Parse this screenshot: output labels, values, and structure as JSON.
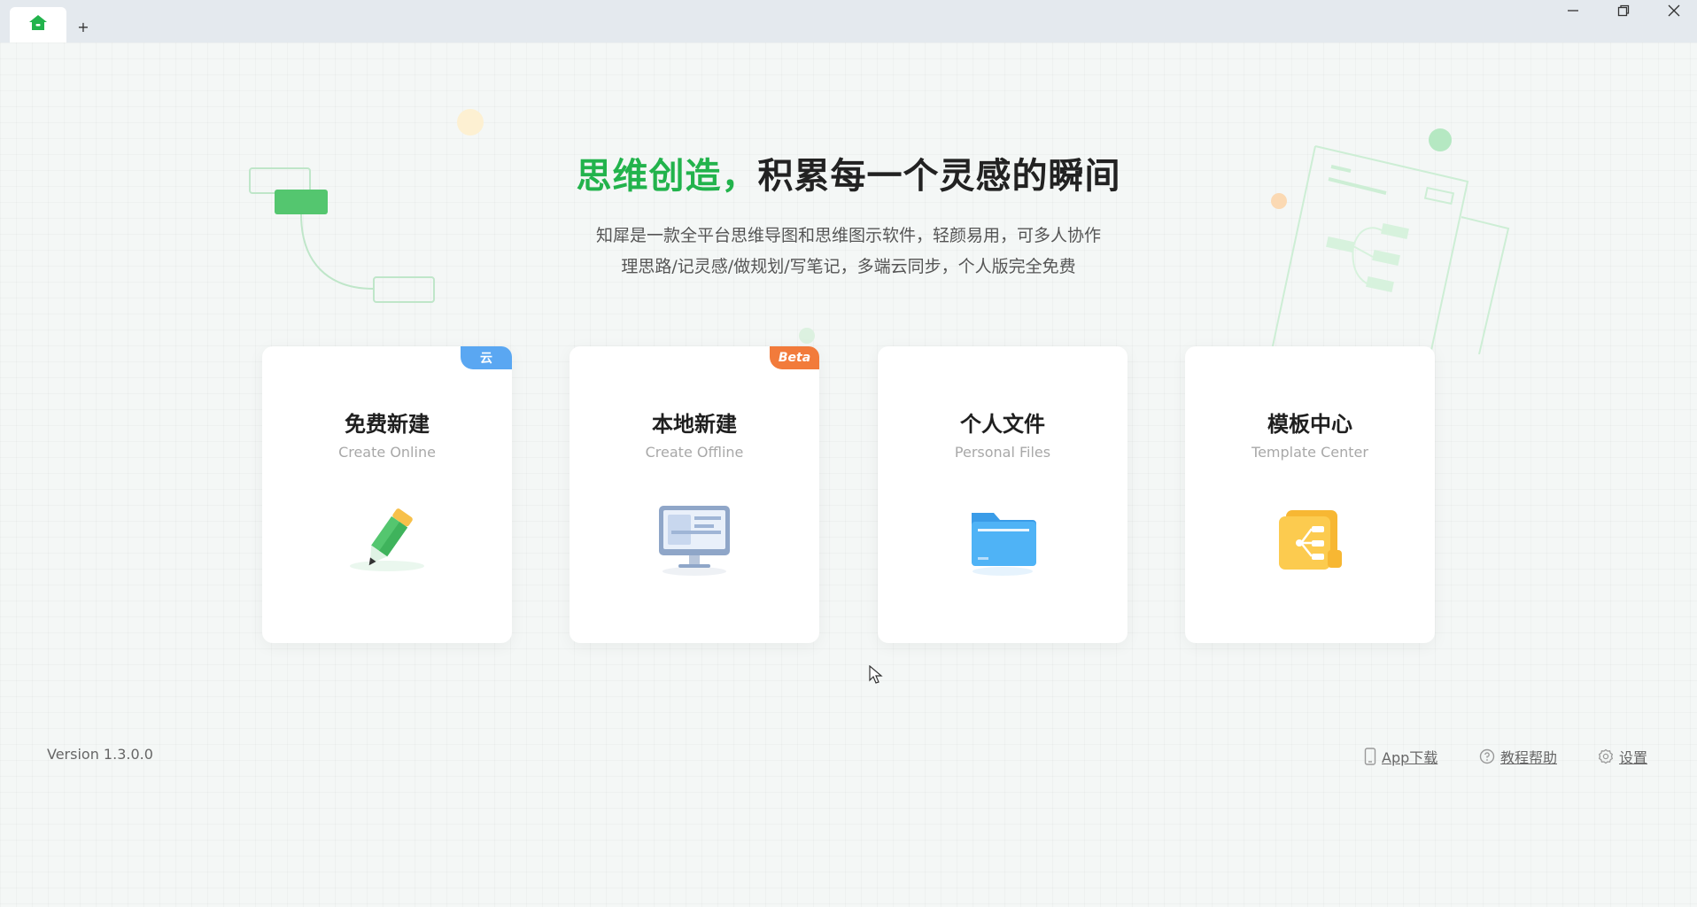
{
  "titlebar": {
    "tabs": [
      {
        "icon": "home-icon"
      }
    ],
    "add_tab_label": "+",
    "window_controls": [
      "minimize-icon",
      "restore-icon",
      "close-icon"
    ]
  },
  "hero": {
    "title_accent": "思维创造，",
    "title_rest": "积累每一个灵感的瞬间",
    "subtitle_line1": "知犀是一款全平台思维导图和思维图示软件，轻颜易用，可多人协作",
    "subtitle_line2": "理思路/记灵感/做规划/写笔记，多端云同步，个人版完全免费"
  },
  "cards": [
    {
      "title": "免费新建",
      "subtitle": "Create Online",
      "badge": "云",
      "badge_color": "#5aa7f2",
      "icon": "pencil-icon"
    },
    {
      "title": "本地新建",
      "subtitle": "Create Offline",
      "badge": "Beta",
      "badge_color": "#f27b3b",
      "icon": "monitor-icon"
    },
    {
      "title": "个人文件",
      "subtitle": "Personal Files",
      "badge": "",
      "icon": "folder-icon"
    },
    {
      "title": "模板中心",
      "subtitle": "Template Center",
      "badge": "",
      "icon": "template-icon"
    }
  ],
  "footer": {
    "version": "Version 1.3.0.0",
    "links": [
      {
        "label": "App下载",
        "icon": "phone-icon"
      },
      {
        "label": "教程帮助",
        "icon": "help-icon"
      },
      {
        "label": "设置",
        "icon": "gear-icon"
      }
    ]
  },
  "colors": {
    "accent": "#22b34c",
    "cloud_badge": "#5aa7f2",
    "beta_badge": "#f27b3b"
  }
}
